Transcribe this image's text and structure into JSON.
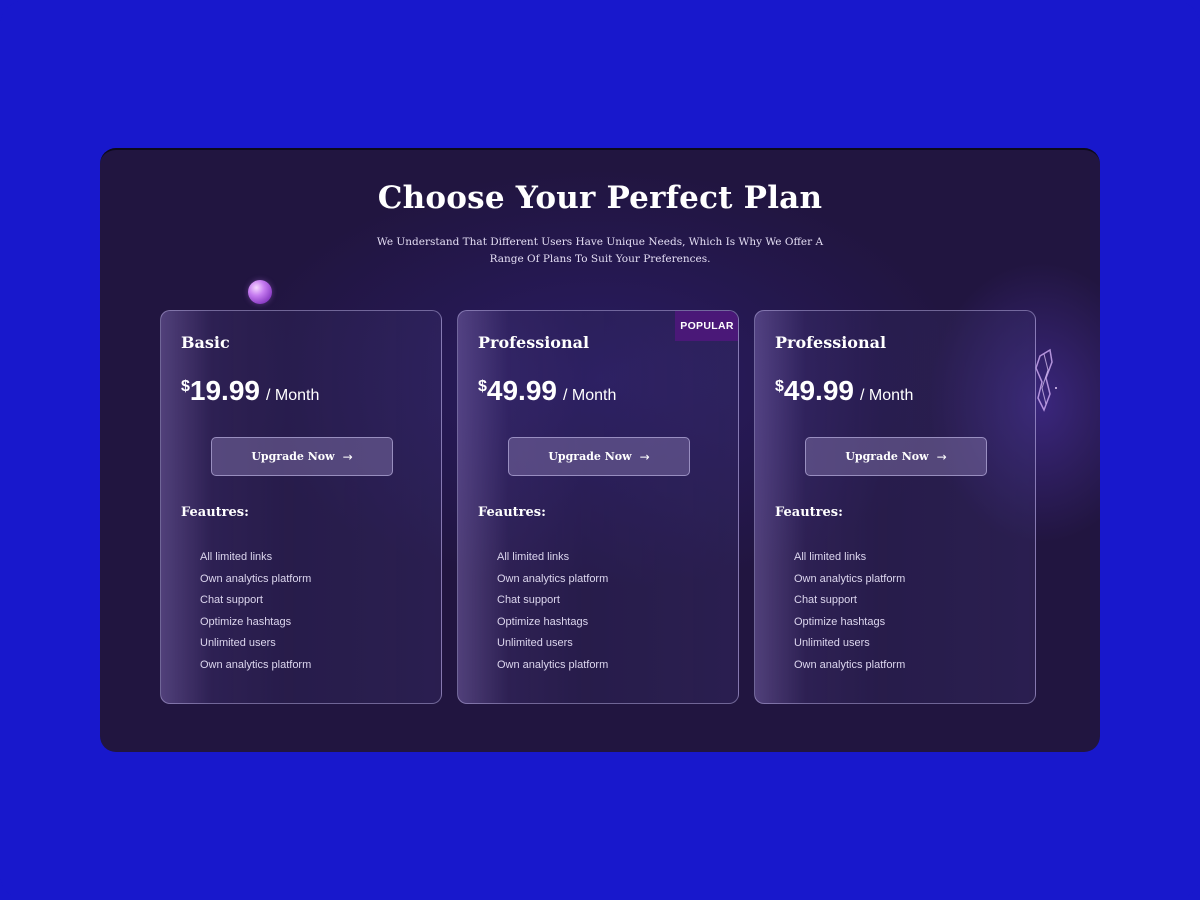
{
  "header": {
    "title": "Choose Your Perfect Plan",
    "subtitle": "We Understand That Different Users Have Unique Needs, Which Is Why We Offer A Range Of Plans To Suit Your Preferences."
  },
  "plans": [
    {
      "name": "Basic",
      "currency": "$",
      "amount": "19.99",
      "period": "/ Month",
      "button_label": "Upgrade Now",
      "features_heading": "Feautres:",
      "features": [
        "All limited links",
        "Own analytics platform",
        "Chat support",
        "Optimize hashtags",
        "Unlimited users",
        "Own analytics platform"
      ]
    },
    {
      "name": "Professional",
      "badge": "POPULAR",
      "currency": "$",
      "amount": "49.99",
      "period": "/ Month",
      "button_label": "Upgrade Now",
      "features_heading": "Feautres:",
      "features": [
        "All limited links",
        "Own analytics platform",
        "Chat support",
        "Optimize hashtags",
        "Unlimited users",
        "Own analytics platform"
      ]
    },
    {
      "name": "Professional",
      "currency": "$",
      "amount": "49.99",
      "period": "/ Month",
      "button_label": "Upgrade Now",
      "features_heading": "Feautres:",
      "features": [
        "All limited links",
        "Own analytics platform",
        "Chat support",
        "Optimize hashtags",
        "Unlimited users",
        "Own analytics platform"
      ]
    }
  ],
  "icons": {
    "button_arrow": "arrow-right-icon",
    "decor_orb": "orb-decoration",
    "decor_crystal": "crystal-decoration"
  },
  "colors": {
    "outer_background": "#1818cc",
    "panel_background": "#211540",
    "badge_background": "#4a1878"
  }
}
